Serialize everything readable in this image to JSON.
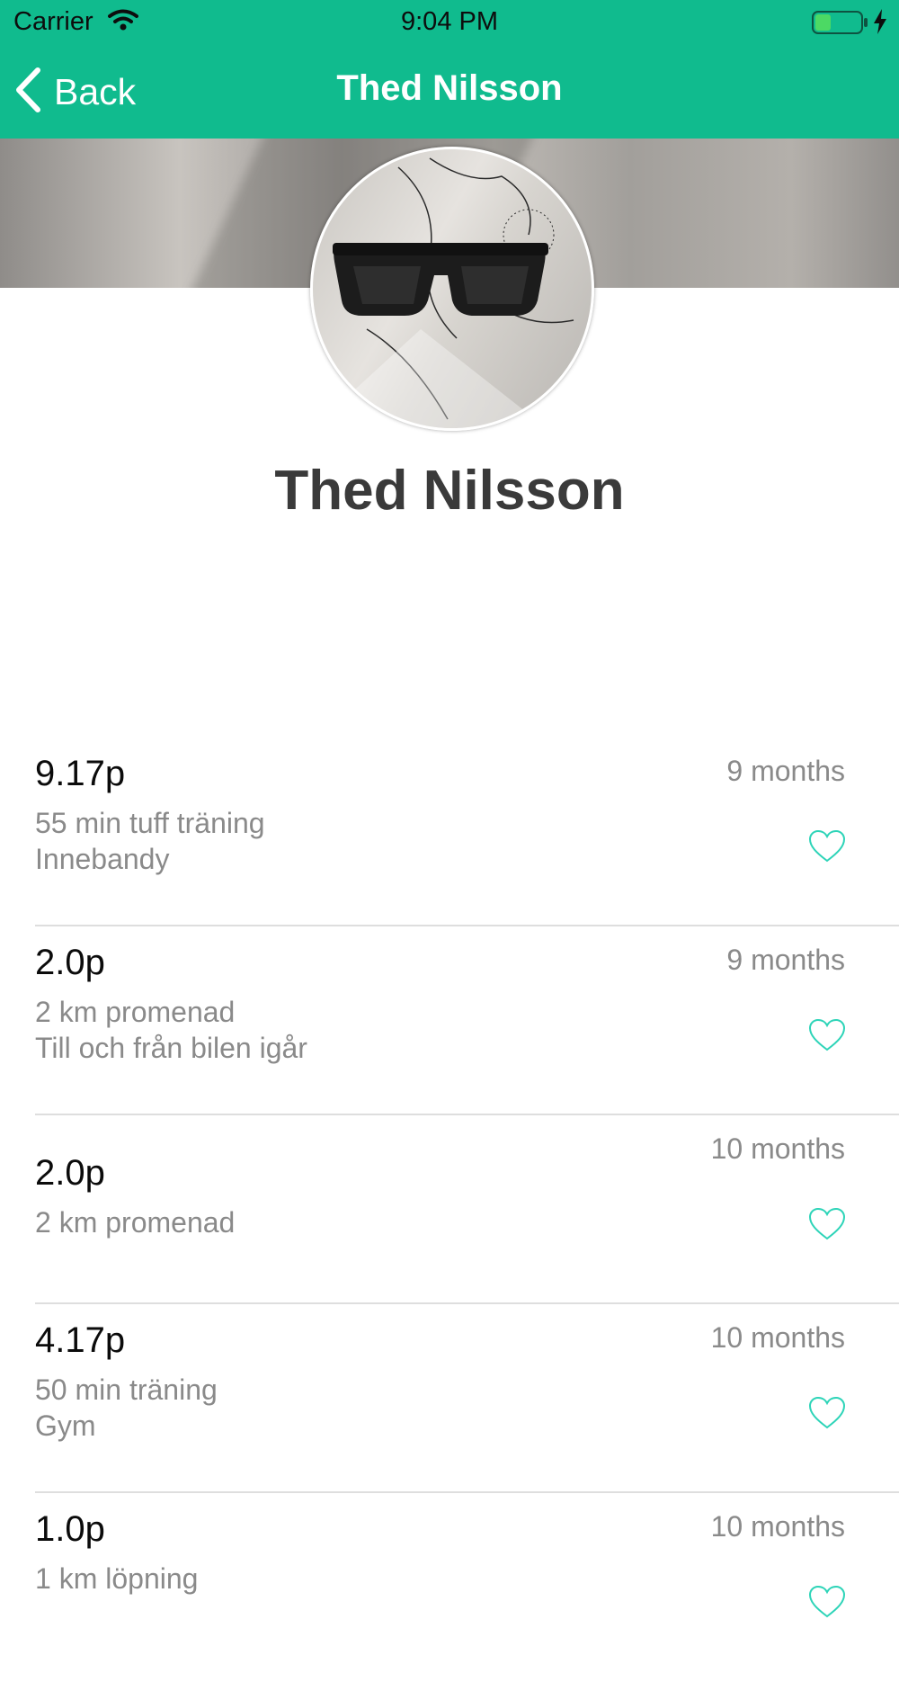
{
  "status_bar": {
    "carrier": "Carrier",
    "time": "9:04 PM"
  },
  "nav": {
    "back_label": "Back",
    "title": "Thed Nilsson"
  },
  "profile": {
    "name": "Thed Nilsson"
  },
  "feed": [
    {
      "points": "9.17p",
      "activity": "55 min tuff träning",
      "note": "Innebandy",
      "time": "9 months"
    },
    {
      "points": "2.0p",
      "activity": "2 km promenad",
      "note": "Till och från bilen igår",
      "time": "9 months"
    },
    {
      "points": "2.0p",
      "activity": "2 km promenad",
      "note": "",
      "time": "10 months"
    },
    {
      "points": "4.17p",
      "activity": "50 min träning",
      "note": "Gym",
      "time": "10 months"
    },
    {
      "points": "1.0p",
      "activity": "1 km löpning",
      "note": "",
      "time": "10 months"
    }
  ],
  "colors": {
    "accent": "#10bb8e",
    "heart": "#2dd4b8",
    "battery_fill": "#4cd964"
  },
  "icons": {
    "back": "chevron-left-icon",
    "wifi": "wifi-icon",
    "battery": "battery-icon",
    "charging": "bolt-icon",
    "like": "heart-outline-icon"
  }
}
